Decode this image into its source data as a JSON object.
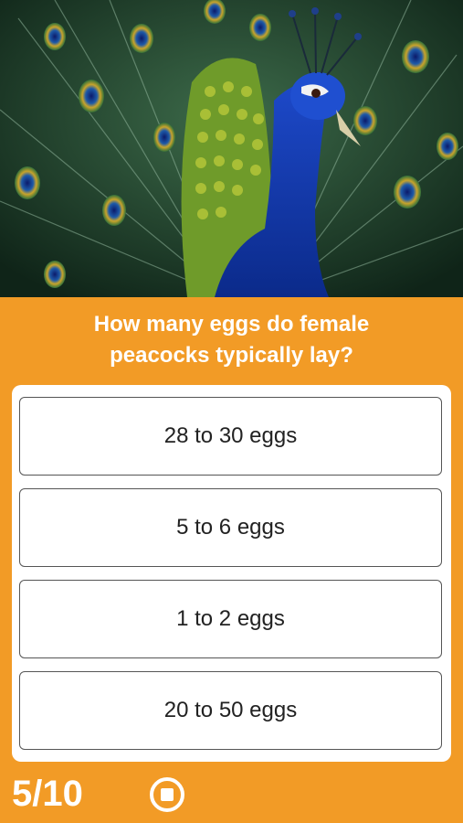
{
  "image": {
    "subject": "peacock-photo"
  },
  "question": {
    "line1": "How many eggs do female",
    "line2": "peacocks typically lay?"
  },
  "answers": [
    {
      "label": "28 to 30 eggs"
    },
    {
      "label": "5 to 6 eggs"
    },
    {
      "label": "1 to 2 eggs"
    },
    {
      "label": "20 to 50 eggs"
    }
  ],
  "footer": {
    "progress": "5/10",
    "stop_icon": "stop-circle-icon"
  },
  "colors": {
    "background": "#F29B26",
    "card": "#FFFFFF",
    "text": "#222222"
  }
}
